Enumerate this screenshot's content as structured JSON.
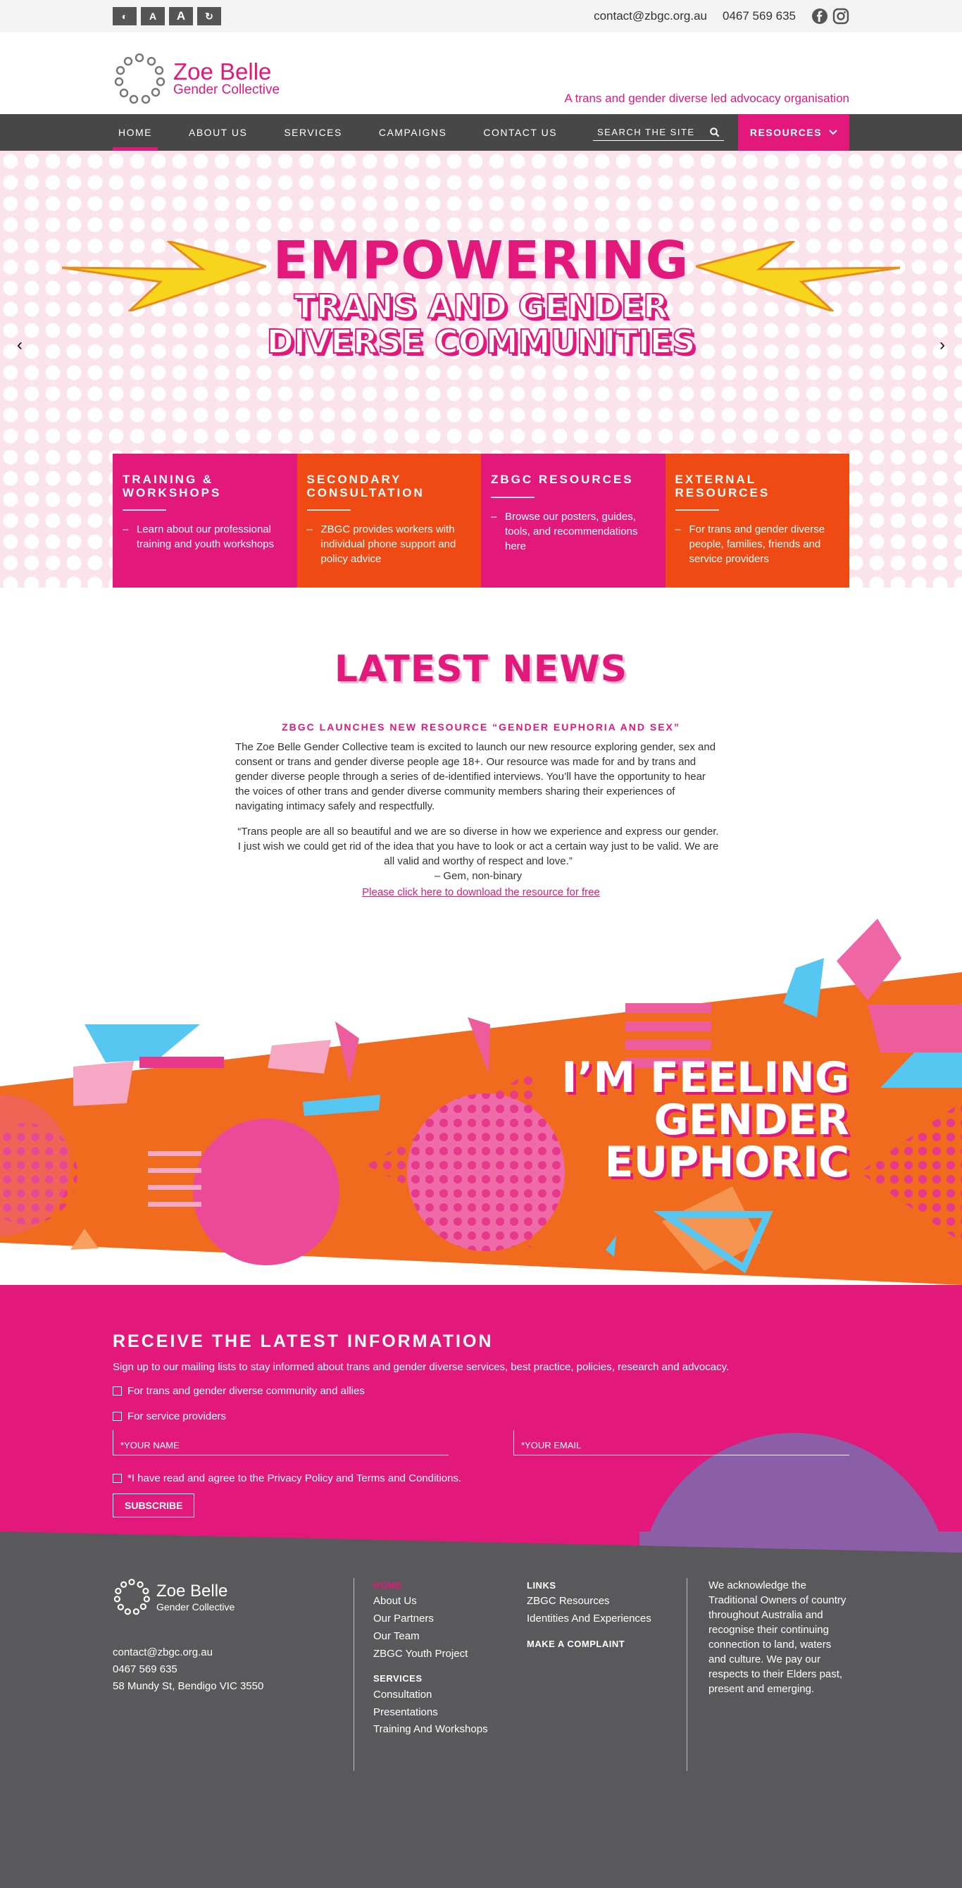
{
  "topbar": {
    "a11y": [
      "◐",
      "A",
      "A",
      "↻"
    ],
    "email": "contact@zbgc.org.au",
    "phone": "0467 569 635"
  },
  "header": {
    "logo_line1": "Zoe Belle",
    "logo_line2": "Gender Collective",
    "tagline": "A trans and gender diverse led advocacy organisation"
  },
  "nav": {
    "items": [
      "HOME",
      "ABOUT US",
      "SERVICES",
      "CAMPAIGNS",
      "CONTACT US"
    ],
    "search_placeholder": "SEARCH THE SITE",
    "resources": "RESOURCES"
  },
  "hero": {
    "line1": "EMPOWERING",
    "line2": "TRANS AND GENDER",
    "line3": "DIVERSE COMMUNITIES",
    "prev": "‹",
    "next": "›"
  },
  "cards": [
    {
      "title": "TRAINING & WORKSHOPS",
      "text": "Learn about our professional training and youth workshops"
    },
    {
      "title": "SECONDARY CONSULTATION",
      "text": "ZBGC provides workers with individual phone support and policy advice"
    },
    {
      "title": "ZBGC RESOURCES",
      "text": "Browse our posters, guides, tools, and recommendations here"
    },
    {
      "title": "EXTERNAL RESOURCES",
      "text": "For trans and gender diverse people, families, friends and service providers"
    }
  ],
  "news": {
    "title": "LATEST NEWS",
    "headline": "ZBGC LAUNCHES NEW RESOURCE “GENDER EUPHORIA AND SEX”",
    "body": "The Zoe Belle Gender Collective team is excited to launch our new resource exploring gender, sex and consent or trans and gender diverse people age 18+. Our resource was made for and by trans and gender diverse people through a series of de-identified interviews. You’ll have the opportunity to hear the voices of other trans and gender diverse community members sharing their experiences of navigating intimacy safely and respectfully.",
    "quote": "“Trans people are all so beautiful and we are so diverse in how we experience and express our gender. I just wish we could get rid of the idea that you have to look or act a certain way just to be valid. We are all valid and worthy of respect and love.”",
    "quote_attr": "– Gem, non-binary",
    "link": "Please click here to download the resource for free"
  },
  "banner": {
    "line1": "I’M FEELING",
    "line2": "GENDER",
    "line3": "EUPHORIC"
  },
  "subscribe": {
    "title": "RECEIVE THE LATEST INFORMATION",
    "desc": "Sign up to our mailing lists to stay informed about trans and gender diverse services, best practice, policies, research and advocacy.",
    "opt1": "For trans and gender diverse community and allies",
    "opt2": "For service providers",
    "name_placeholder": "*YOUR NAME",
    "email_placeholder": "*YOUR EMAIL",
    "agree": "*I have read and agree to the Privacy Policy and Terms and Conditions.",
    "button": "SUBSCRIBE"
  },
  "footer": {
    "logo_line1": "Zoe Belle",
    "logo_line2": "Gender Collective",
    "email": "contact@zbgc.org.au",
    "phone": "0467 569 635",
    "address": "58 Mundy St, Bendigo VIC 3550",
    "col1_head": "HOME",
    "col1_links": [
      "About Us",
      "Our Partners",
      "Our Team",
      "ZBGC Youth Project"
    ],
    "col1_head2": "SERVICES",
    "col1_links2": [
      "Consultation",
      "Presentations",
      "Training And Workshops"
    ],
    "col2_head": "LINKS",
    "col2_links": [
      "ZBGC Resources",
      "Identities And Experiences"
    ],
    "col2_head2": "MAKE A COMPLAINT",
    "ack": "We acknowledge the Traditional Owners of country throughout Australia and recognise their continuing connection to land, waters and culture. We pay our respects to their Elders past, present and emerging."
  },
  "colors": {
    "pink": "#e3187b",
    "orange": "#ef4a14",
    "grey": "#59595b",
    "purple": "#8a5fa8",
    "cyan": "#56c7f0"
  }
}
